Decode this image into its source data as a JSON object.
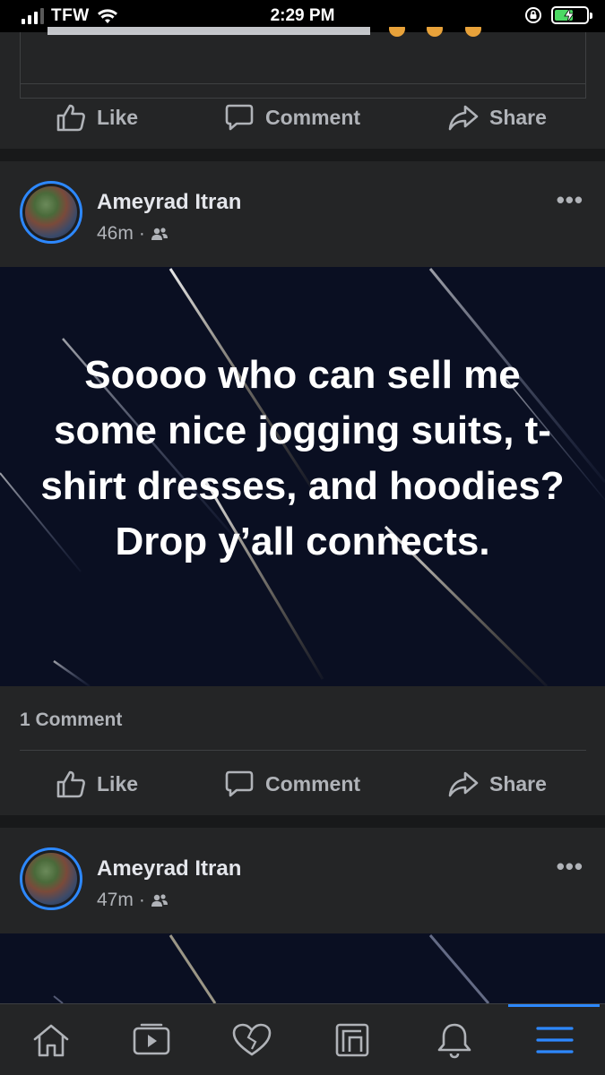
{
  "status_bar": {
    "carrier": "TFW",
    "time": "2:29 PM"
  },
  "actions": {
    "like": "Like",
    "comment": "Comment",
    "share": "Share"
  },
  "posts": [
    {
      "author": "Ameyrad Itran",
      "time": "46m",
      "audience_icon": "friends-icon",
      "text": "Soooo who can sell me some nice jogging suits, t-shirt dresses, and hoodies? Drop y’all connects.",
      "comment_count": "1 Comment"
    },
    {
      "author": "Ameyrad Itran",
      "time": "47m",
      "audience_icon": "friends-icon"
    }
  ],
  "bottom_nav": [
    "home-icon",
    "watch-icon",
    "dating-icon",
    "pages-icon",
    "notifications-icon",
    "menu-icon"
  ],
  "colors": {
    "accent": "#2d88ff",
    "background": "#18191a",
    "card": "#242526",
    "post_background": "#0a0f22",
    "secondary_text": "#b0b3b8"
  }
}
